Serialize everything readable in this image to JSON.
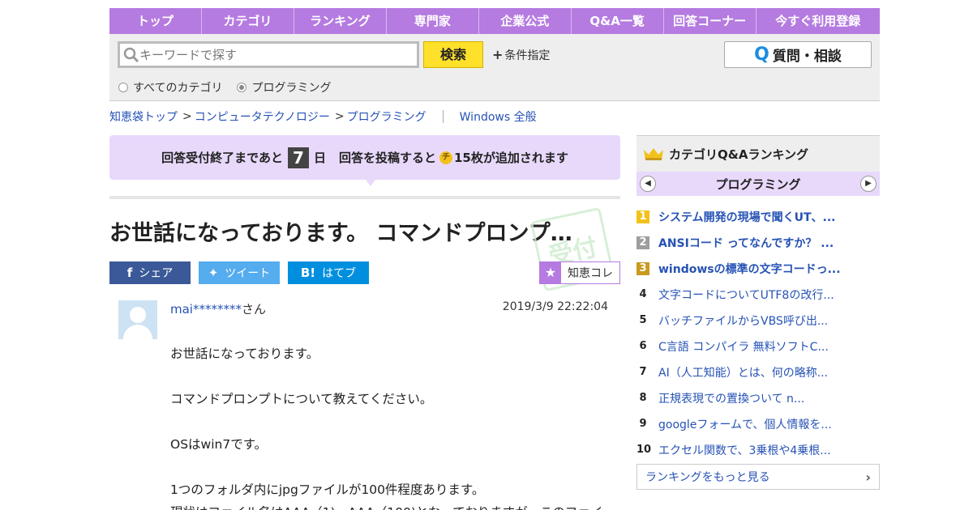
{
  "nav": [
    "トップ",
    "カテゴリ",
    "ランキング",
    "専門家",
    "企業公式",
    "Q&A一覧",
    "回答コーナー",
    "今すぐ利用登録"
  ],
  "search": {
    "placeholder": "キーワードで探す",
    "button": "検索",
    "condition": "条件指定",
    "scopes": [
      {
        "label": "すべてのカテゴリ",
        "selected": false
      },
      {
        "label": "プログラミング",
        "selected": true
      }
    ],
    "ask_button": "質問・相談"
  },
  "breadcrumb": {
    "items": [
      "知恵袋トップ",
      "コンピュータテクノロジー",
      "プログラミング"
    ],
    "extra": "Windows 全般"
  },
  "notice": {
    "prefix": "回答受付終了まであと",
    "days": "7",
    "day_unit": "日",
    "middle": "回答を投稿すると",
    "coin": "チ",
    "suffix": "15枚が追加されます"
  },
  "question": {
    "title": "お世話になっております。 コマンドプロンプ…",
    "share": {
      "facebook": "シェア",
      "twitter": "ツイート",
      "hatena": "はてブ"
    },
    "collect": "知恵コレ",
    "user": "mai********",
    "user_suffix": "さん",
    "date": "2019/3/9 22:22:04",
    "body": [
      "お世話になっております。",
      "",
      "コマンドプロンプトについて教えてください。",
      "",
      "OSはwin7です。",
      "",
      "1つのフォルダ内にjpgファイルが100件程度あります。",
      "現状はファイル名はAAA（1)～AAA（100)となっておりますが、このファイ"
    ]
  },
  "ranking": {
    "title": "カテゴリQ&Aランキング",
    "category": "プログラミング",
    "items": [
      {
        "num": "1",
        "text": "システム開発の現場で聞くUT、..."
      },
      {
        "num": "2",
        "text": "ANSIコード ってなんですか？ ..."
      },
      {
        "num": "3",
        "text": "windowsの標準の文字コードっ..."
      },
      {
        "num": "4",
        "text": "文字コードについてUTF8の改行..."
      },
      {
        "num": "5",
        "text": "バッチファイルからVBS呼び出..."
      },
      {
        "num": "6",
        "text": "C言語 コンパイラ 無料ソフトC..."
      },
      {
        "num": "7",
        "text": "AI（人工知能）とは、何の略称..."
      },
      {
        "num": "8",
        "text": "正規表現での置換ついて n..."
      },
      {
        "num": "9",
        "text": "googleフォームで、個人情報を..."
      },
      {
        "num": "10",
        "text": "エクセル関数で、3乗根や4乗根..."
      }
    ],
    "more": "ランキングをもっと見る"
  },
  "colors": {
    "accent": "#b57be0",
    "accent_light": "#e8d9fb",
    "link": "#2652b5",
    "search_button": "#ffe02a"
  }
}
